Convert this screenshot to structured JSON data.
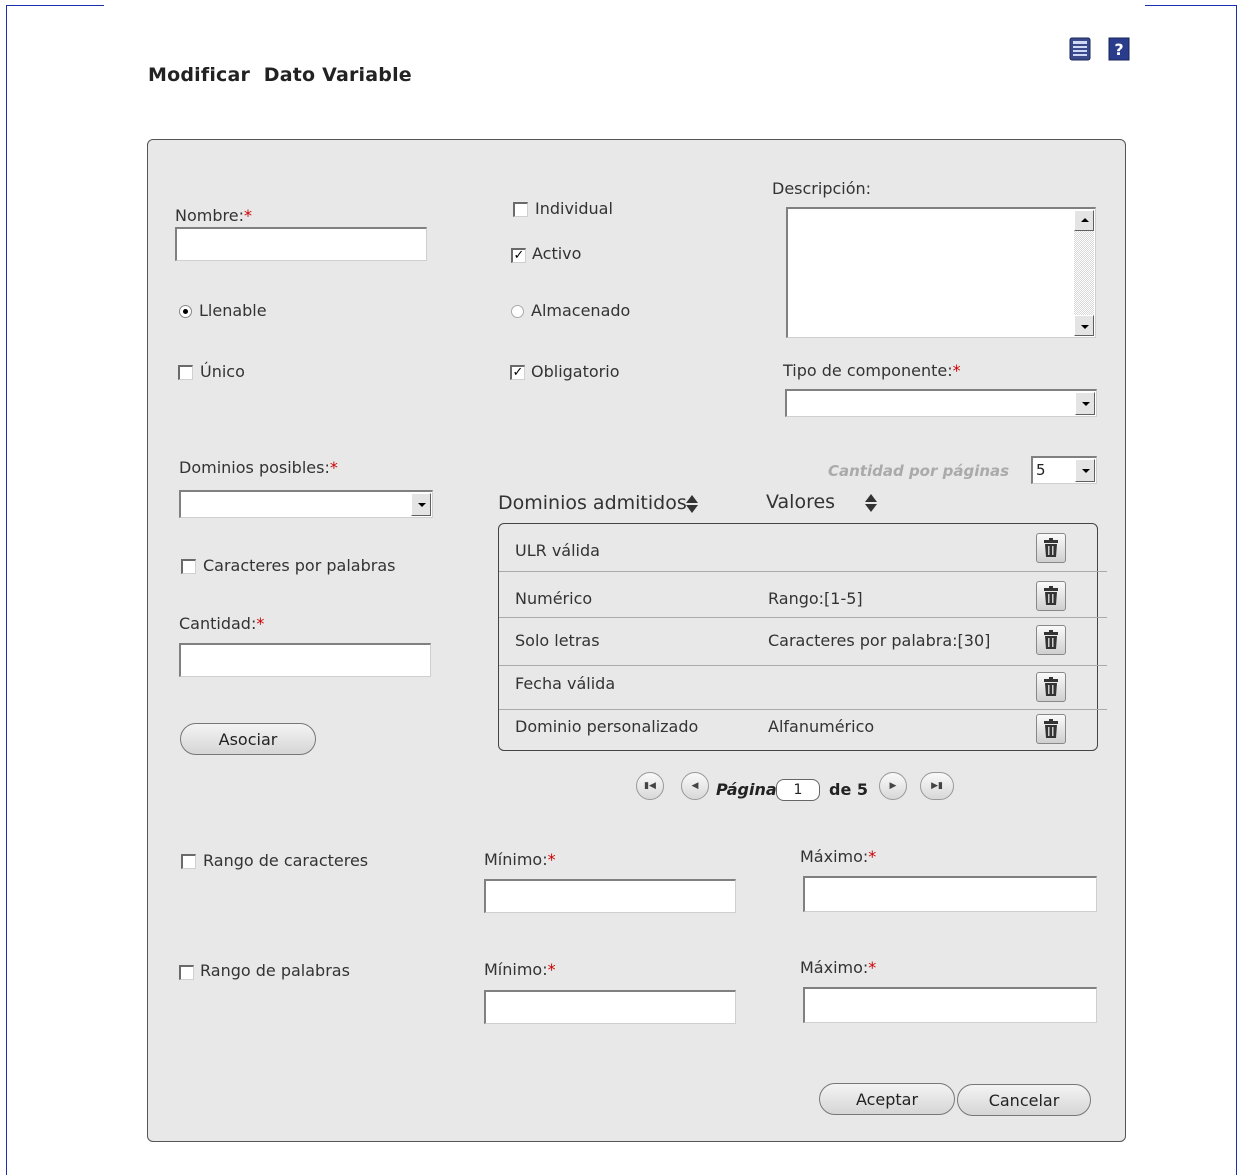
{
  "title": "Modificar  Dato Variable",
  "icons": {
    "list": "list-icon",
    "help": "help-icon"
  },
  "form": {
    "nombre_label": "Nombre:",
    "nombre_value": "",
    "required_mark": "*",
    "individual_label": "Individual",
    "individual_checked": false,
    "activo_label": "Activo",
    "activo_checked": true,
    "descripcion_label": "Descripción:",
    "descripcion_value": "",
    "llenable_label": "Llenable",
    "llenable_selected": true,
    "almacenado_label": "Almacenado",
    "almacenado_selected": false,
    "unico_label": "Único",
    "unico_checked": false,
    "obligatorio_label": "Obligatorio",
    "obligatorio_checked": true,
    "tipo_componente_label": "Tipo de componente:",
    "tipo_componente_value": "",
    "dominios_posibles_label": "Dominios posibles:",
    "dominios_posibles_value": "",
    "caracteres_por_palabras_label": "Caracteres por palabras",
    "cantidad_label": "Cantidad:",
    "cantidad_value": "",
    "asociar_button": "Asociar",
    "rango_caracteres_label": "Rango de caracteres",
    "rango_palabras_label": "Rango de palabras",
    "minimo_label": "Mínimo:",
    "maximo_label": "Máximo:",
    "aceptar_button": "Aceptar",
    "cancelar_button": "Cancelar"
  },
  "table": {
    "cantidad_por_paginas_label": "Cantidad por páginas",
    "cantidad_por_paginas_value": "5",
    "col_dominios": "Dominios admitidos",
    "col_valores": "Valores",
    "rows": [
      {
        "dominio": "ULR válida",
        "valor": ""
      },
      {
        "dominio": "Numérico",
        "valor": "Rango:[1-5]"
      },
      {
        "dominio": "Solo letras",
        "valor": "Caracteres por palabra:[30]"
      },
      {
        "dominio": "Fecha válida",
        "valor": ""
      },
      {
        "dominio": "Dominio personalizado",
        "valor": "Alfanumérico"
      }
    ]
  },
  "pager": {
    "pagina_label": "Página",
    "current_page": "1",
    "de_label": "de 5"
  }
}
